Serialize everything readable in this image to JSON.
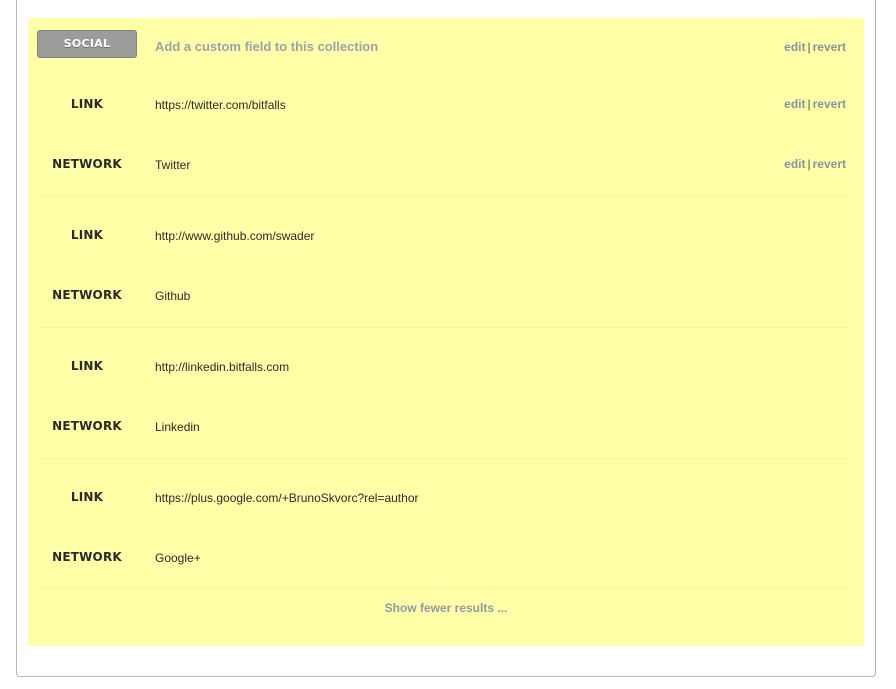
{
  "header": {
    "badge": "SOCIAL",
    "add_field": "Add a custom field to this collection",
    "edit": "edit",
    "sep": "|",
    "revert": "revert"
  },
  "entries": [
    {
      "link_label": "LINK",
      "link": "https://twitter.com/bitfalls",
      "network_label": "NETWORK",
      "network": "Twitter"
    },
    {
      "link_label": "LINK",
      "link": "http://www.github.com/swader",
      "network_label": "NETWORK",
      "network": "Github"
    },
    {
      "link_label": "LINK",
      "link": "http://linkedin.bitfalls.com",
      "network_label": "NETWORK",
      "network": "Linkedin"
    },
    {
      "link_label": "LINK",
      "link": "https://plus.google.com/+BrunoSkvorc?rel=author",
      "network_label": "NETWORK",
      "network": "Google+"
    }
  ],
  "show_fewer": "Show fewer results ..."
}
